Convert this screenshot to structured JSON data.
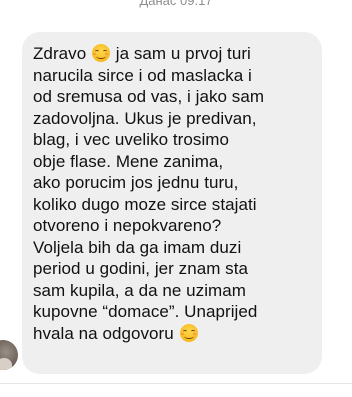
{
  "conversation": {
    "date_label": "Данас 09.17",
    "incoming_message": {
      "lines": [
        [
          "Zdravo ",
          "ja sam u prvoj turi"
        ],
        [
          "narucila sirce i od maslacka i"
        ],
        [
          "od sremusa od vas, i jako sam"
        ],
        [
          "zadovoljna. Ukus je predivan,"
        ],
        [
          "blag, i vec uveliko trosimo"
        ],
        [
          "obje flase. Mene zanima,"
        ],
        [
          "ako porucim jos jednu turu,"
        ],
        [
          "koliko dugo moze sirce stajati"
        ],
        [
          "otvoreno i nepokvareno?"
        ],
        [
          "Voljela bih da ga imam duzi"
        ],
        [
          "period u godini, jer znam sta"
        ],
        [
          "sam kupila, a da ne uzimam"
        ],
        [
          "kupovne “domace”. Unaprijed"
        ],
        [
          "hvala na odgovoru "
        ]
      ],
      "emoji": "smiling-face-with-smiling-eyes-icon"
    }
  }
}
